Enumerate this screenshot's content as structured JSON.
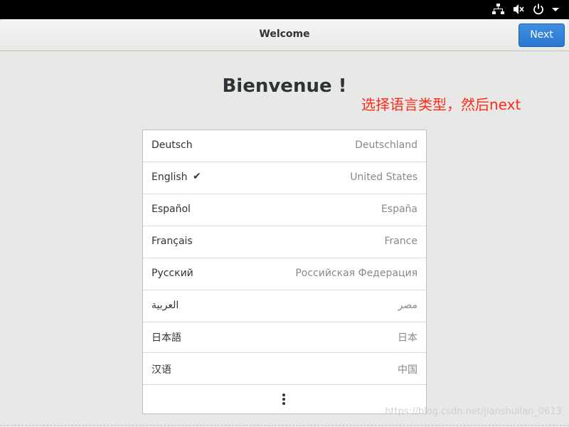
{
  "topbar": {
    "icons": [
      "network-icon",
      "volume-muted-icon",
      "power-icon",
      "chevron-down-icon"
    ]
  },
  "window": {
    "title": "Welcome",
    "next_label": "Next"
  },
  "main": {
    "heading": "Bienvenue !",
    "annotation": "选择语言类型，然后next",
    "languages": [
      {
        "name": "Deutsch",
        "region": "Deutschland",
        "selected": false
      },
      {
        "name": "English",
        "region": "United States",
        "selected": true,
        "check": "✔"
      },
      {
        "name": "Español",
        "region": "España",
        "selected": false
      },
      {
        "name": "Français",
        "region": "France",
        "selected": false
      },
      {
        "name": "Русский",
        "region": "Российская Федерация",
        "selected": false
      },
      {
        "name": "العربية",
        "region": "مصر",
        "selected": false
      },
      {
        "name": "日本語",
        "region": "日本",
        "selected": false
      },
      {
        "name": "汉语",
        "region": "中国",
        "selected": false
      }
    ],
    "more_icon": "vertical-ellipsis-icon"
  },
  "watermark": "https://blog.csdn.net/jianshuilan_0613",
  "colors": {
    "accent": "#2b78d3",
    "annotation": "#ff2a1a",
    "topbar": "#000000"
  }
}
